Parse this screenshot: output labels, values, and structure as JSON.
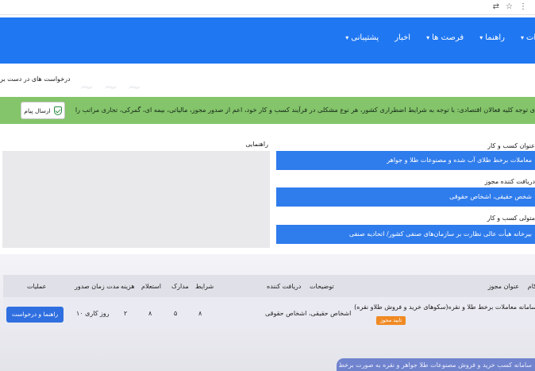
{
  "browser": {
    "icons": [
      "translate-icon",
      "star-icon",
      "menu-icon"
    ]
  },
  "nav": {
    "items": [
      {
        "label": "رات",
        "has_caret": true
      },
      {
        "label": "راهنما",
        "has_caret": true
      },
      {
        "label": "فرصت ها",
        "has_caret": true
      },
      {
        "label": "اخبار",
        "has_caret": false
      },
      {
        "label": "پشتیبانی",
        "has_caret": true
      }
    ]
  },
  "breadcrumb": "درخواست های در دست بر",
  "alert": {
    "text": "ی توجه کلیه فعالان اقتصادی: با توجه به شرایط اضطراری کشور، هر نوع مشکلی در فرآیند کسب و کار خود، اعم از صدور مجوز، مالیاتی، بیمه ای، گمرکی، تجاری مراتب را اطلاع دهید تا پیگیری کنیم.",
    "button_label": "ارسال پیام"
  },
  "details": {
    "guide_label": "راهنمایی",
    "fields": [
      {
        "label": "عنوان کسب و کار",
        "value": "معاملات برخط طلای آب شده و مصنوعات طلا و جواهر"
      },
      {
        "label": "دریافت کننده مجوز",
        "value": "شخص حقیقی، اشخاص حقوقی"
      },
      {
        "label": "متولی کسب و کار",
        "value": "بیرخانه هیأت عالی نظارت بر سازمان‌های صنفی کشور/ اتحادیه صنفی"
      }
    ]
  },
  "table": {
    "headers": {
      "row": "کام",
      "title": "عنوان مجوز",
      "description": "توضیحات",
      "recipient": "دریافت کننده",
      "conditions": "شرایط",
      "documents": "مدارک",
      "inquiry": "استعلام",
      "cost": "هزینه",
      "duration": "مدت زمان صدور",
      "actions": "عملیات"
    },
    "rows": [
      {
        "title": "سامانه معاملات برخط طلا و نقره(سکوهای خرید و فروش طلاو نقره)",
        "badge": "تایید مجوز",
        "description": "",
        "recipient": "اشخاص حقیقی، اشخاص حقوقی",
        "conditions": "۸",
        "documents": "۵",
        "inquiry": "۸",
        "cost": "۲",
        "duration": "۱۰ روز کاری",
        "action_label": "راهنما و درخواست"
      }
    ]
  },
  "bottom_ghost_text": "سامانه کسب خرید و فروش مصنوعات طلا جواهر و نقره به صورت برخط"
}
